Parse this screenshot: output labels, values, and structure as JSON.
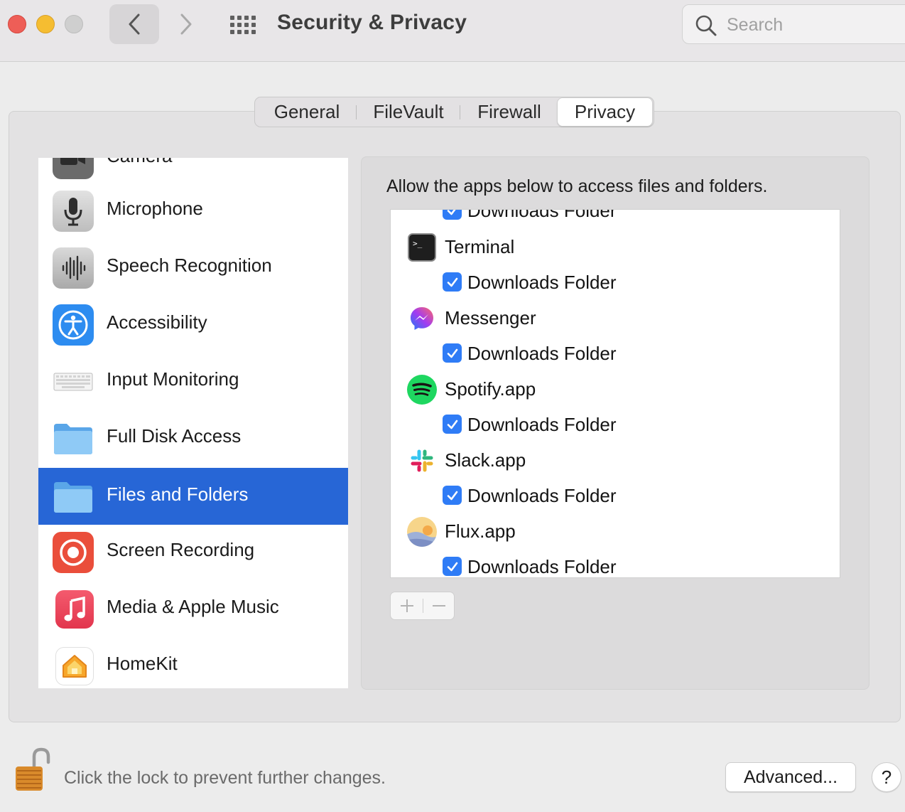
{
  "window": {
    "title": "Security & Privacy",
    "search_placeholder": "Search"
  },
  "tabs": [
    {
      "label": "General",
      "selected": false
    },
    {
      "label": "FileVault",
      "selected": false
    },
    {
      "label": "Firewall",
      "selected": false
    },
    {
      "label": "Privacy",
      "selected": true
    }
  ],
  "sidebar": {
    "items": [
      {
        "label": "Camera",
        "icon": "camera-icon"
      },
      {
        "label": "Microphone",
        "icon": "microphone-icon"
      },
      {
        "label": "Speech Recognition",
        "icon": "waveform-icon"
      },
      {
        "label": "Accessibility",
        "icon": "accessibility-icon"
      },
      {
        "label": "Input Monitoring",
        "icon": "keyboard-icon"
      },
      {
        "label": "Full Disk Access",
        "icon": "folder-icon"
      },
      {
        "label": "Files and Folders",
        "icon": "folder-icon",
        "selected": true
      },
      {
        "label": "Screen Recording",
        "icon": "screen-recording-icon"
      },
      {
        "label": "Media & Apple Music",
        "icon": "music-note-icon"
      },
      {
        "label": "HomeKit",
        "icon": "home-icon"
      }
    ]
  },
  "main": {
    "heading": "Allow the apps below to access files and folders.",
    "apps": [
      {
        "name": "Terminal",
        "icon": "terminal-icon",
        "permission": "Downloads Folder",
        "checked": true
      },
      {
        "name": "Messenger",
        "icon": "messenger-icon",
        "permission": "Downloads Folder",
        "checked": true
      },
      {
        "name": "Spotify.app",
        "icon": "spotify-icon",
        "permission": "Downloads Folder",
        "checked": true
      },
      {
        "name": "Slack.app",
        "icon": "slack-icon",
        "permission": "Downloads Folder",
        "checked": true
      },
      {
        "name": "Flux.app",
        "icon": "flux-icon",
        "permission": "Downloads Folder",
        "checked": true
      }
    ],
    "partial_top_permission": "Downloads Folder"
  },
  "footer": {
    "lock_text": "Click the lock to prevent further changes.",
    "advanced_label": "Advanced...",
    "help_label": "?"
  },
  "colors": {
    "selection": "#2766d6",
    "checkbox": "#2f7cf6"
  }
}
